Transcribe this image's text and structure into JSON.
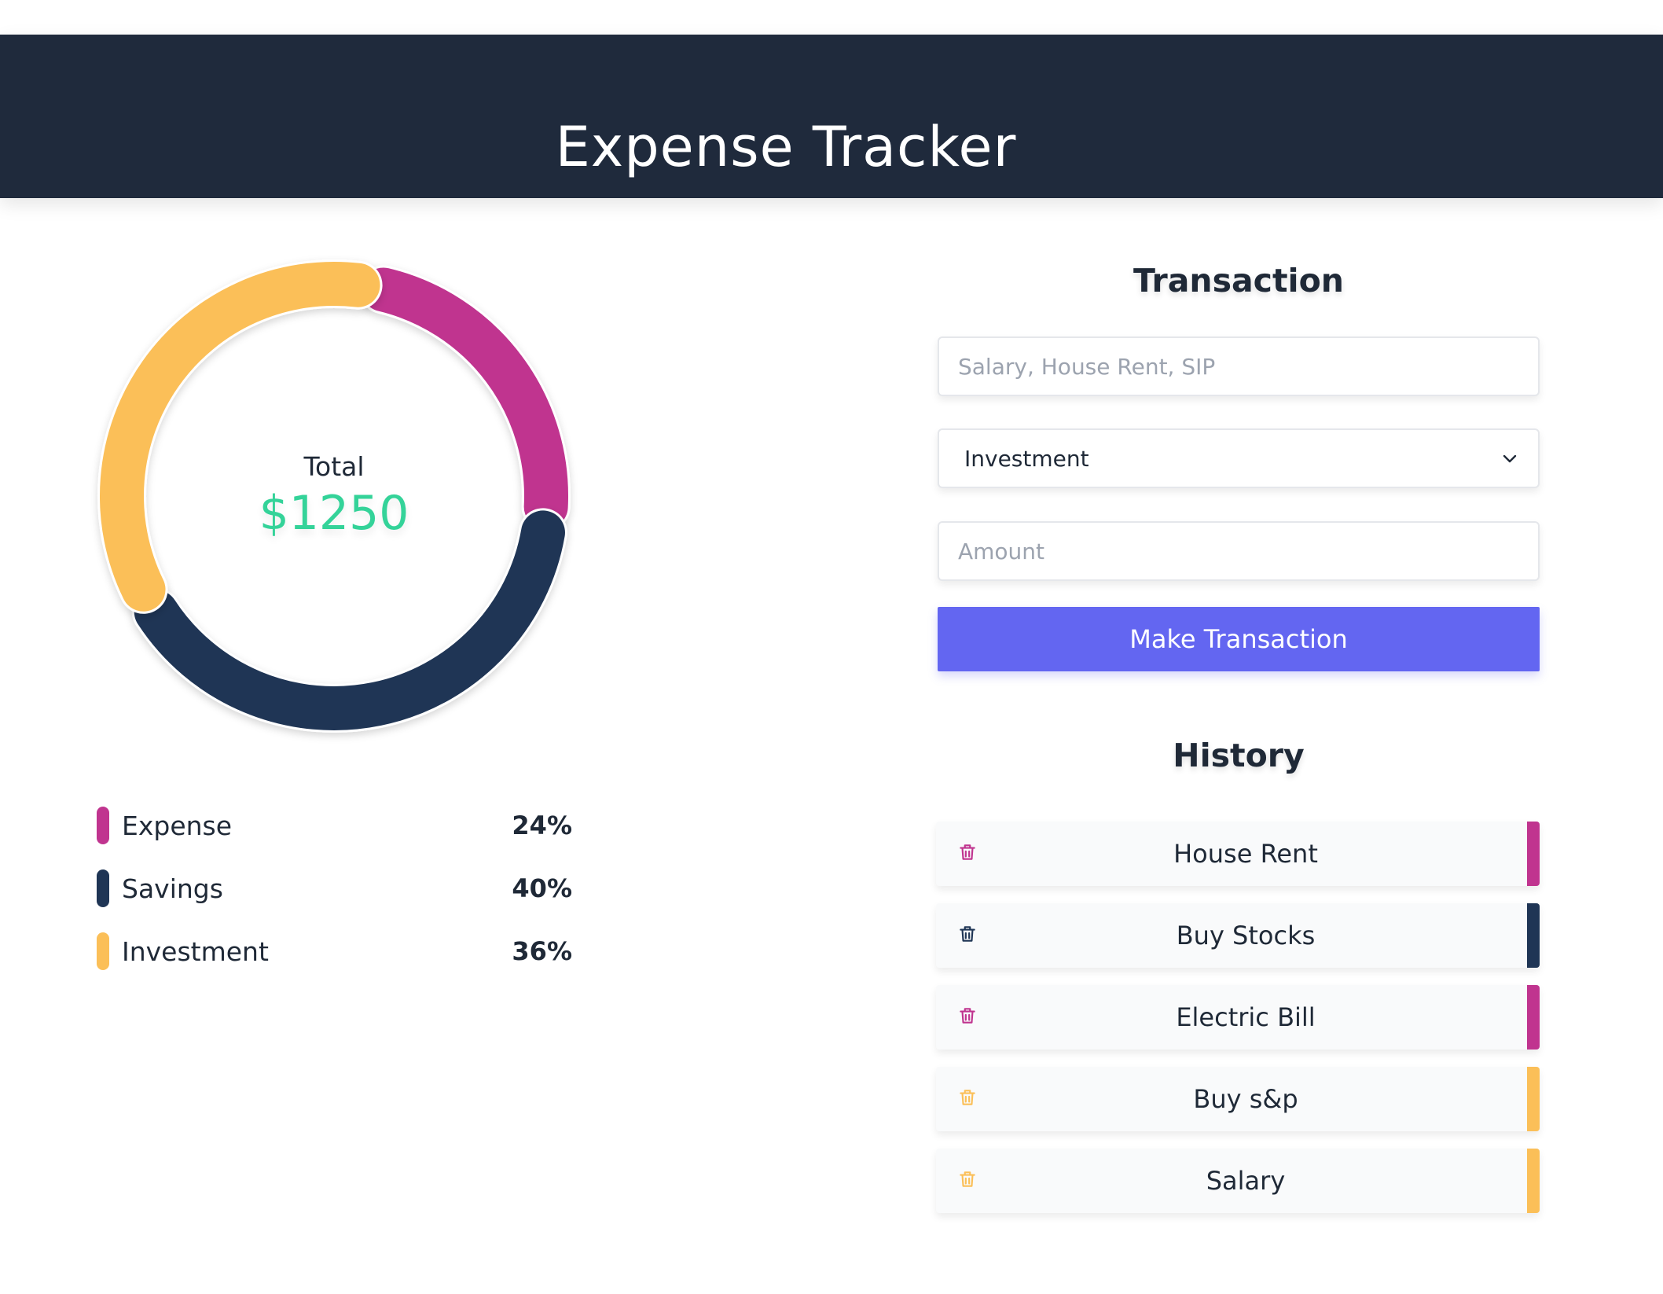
{
  "header": {
    "title": "Expense Tracker"
  },
  "summary": {
    "total_label": "Total",
    "total_value": "$1250"
  },
  "colors": {
    "expense": "#c0348f",
    "savings": "#1f3555",
    "investment": "#fbbf58",
    "accent": "#6366f1",
    "total": "#34d399"
  },
  "chart_data": {
    "type": "pie",
    "categories": [
      "Expense",
      "Savings",
      "Investment"
    ],
    "values": [
      24,
      40,
      36
    ],
    "labels": [
      "24%",
      "40%",
      "36%"
    ]
  },
  "legend": [
    {
      "label": "Expense",
      "value": "24%",
      "color": "#c0348f"
    },
    {
      "label": "Savings",
      "value": "40%",
      "color": "#1f3555"
    },
    {
      "label": "Investment",
      "value": "36%",
      "color": "#fbbf58"
    }
  ],
  "transaction": {
    "title": "Transaction",
    "name_placeholder": "Salary, House Rent, SIP",
    "type_value": "Investment",
    "amount_placeholder": "Amount",
    "submit_label": "Make Transaction"
  },
  "history": {
    "title": "History",
    "items": [
      {
        "label": "House Rent",
        "color": "#c0348f",
        "icon": "trash-icon"
      },
      {
        "label": "Buy Stocks",
        "color": "#1f3555",
        "icon": "trash-icon"
      },
      {
        "label": "Electric Bill",
        "color": "#c0348f",
        "icon": "trash-icon"
      },
      {
        "label": "Buy s&p",
        "color": "#fbbf58",
        "icon": "trash-icon"
      },
      {
        "label": "Salary",
        "color": "#fbbf58",
        "icon": "trash-icon"
      }
    ]
  }
}
